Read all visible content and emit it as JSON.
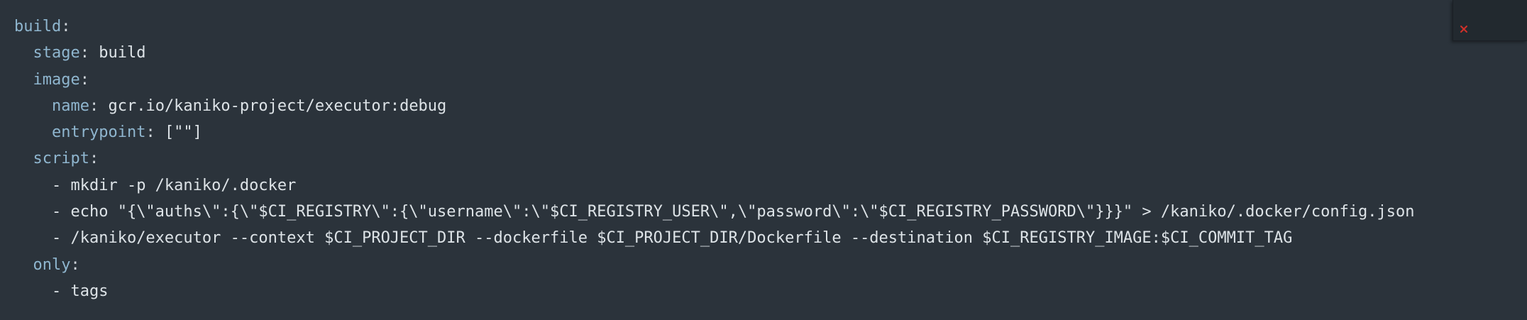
{
  "lines": [
    {
      "key": "build",
      "sep": ":",
      "value": ""
    },
    {
      "indent": "  ",
      "key": "stage",
      "sep": ": ",
      "value": "build"
    },
    {
      "indent": "  ",
      "key": "image",
      "sep": ":",
      "value": ""
    },
    {
      "indent": "    ",
      "key": "name",
      "sep": ": ",
      "value": "gcr.io/kaniko-project/executor:debug"
    },
    {
      "indent": "    ",
      "key": "entrypoint",
      "sep": ": ",
      "value": "[\"\"]"
    },
    {
      "indent": "  ",
      "key": "script",
      "sep": ":",
      "value": ""
    },
    {
      "indent": "    ",
      "item": "- mkdir -p /kaniko/.docker"
    },
    {
      "indent": "    ",
      "item": "- echo \"{\\\"auths\\\":{\\\"$CI_REGISTRY\\\":{\\\"username\\\":\\\"$CI_REGISTRY_USER\\\",\\\"password\\\":\\\"$CI_REGISTRY_PASSWORD\\\"}}}\" > /kaniko/.docker/config.json"
    },
    {
      "indent": "    ",
      "item": "- /kaniko/executor --context $CI_PROJECT_DIR --dockerfile $CI_PROJECT_DIR/Dockerfile --destination $CI_REGISTRY_IMAGE:$CI_COMMIT_TAG"
    },
    {
      "indent": "  ",
      "key": "only",
      "sep": ":",
      "value": ""
    },
    {
      "indent": "    ",
      "item": "- tags"
    }
  ],
  "overlay": {
    "icon": "close-icon",
    "icon_color": "#d0302a"
  },
  "colors": {
    "background": "#2b333b",
    "key": "#8fb6cf",
    "text": "#dde3e7"
  }
}
